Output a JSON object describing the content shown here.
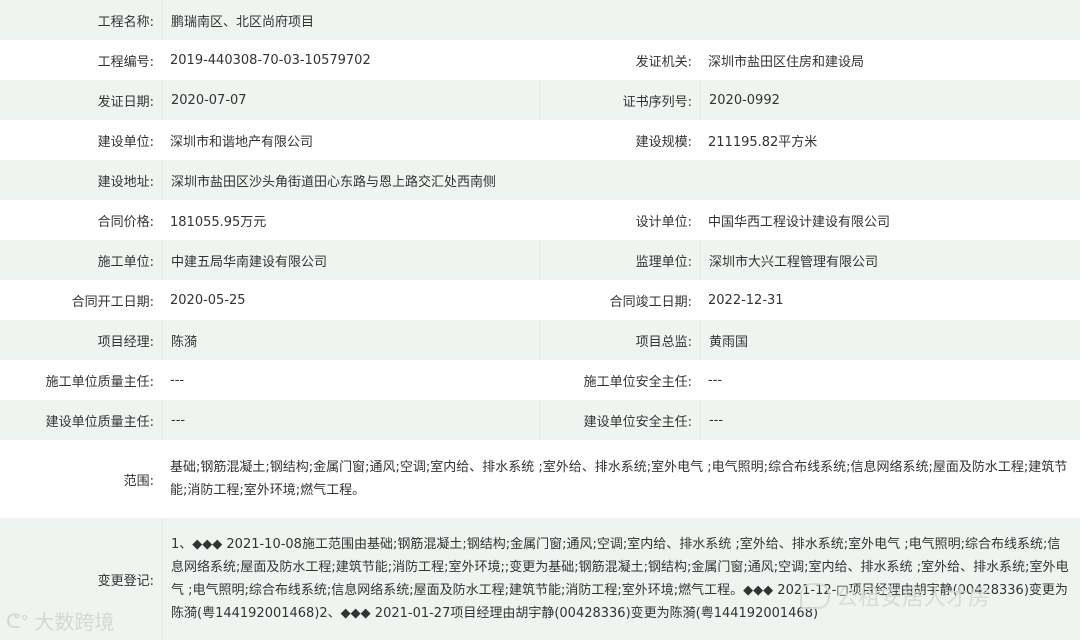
{
  "rows": [
    {
      "l1": "工程名称:",
      "v1": "鹏瑞南区、北区尚府项目"
    },
    {
      "l1": "工程编号:",
      "v1": "2019-440308-70-03-10579702",
      "l2": "发证机关:",
      "v2": "深圳市盐田区住房和建设局"
    },
    {
      "l1": "发证日期:",
      "v1": "2020-07-07",
      "l2": "证书序列号:",
      "v2": "2020-0992"
    },
    {
      "l1": "建设单位:",
      "v1": "深圳市和谐地产有限公司",
      "l2": "建设规模:",
      "v2": "211195.82平方米"
    },
    {
      "l1": "建设地址:",
      "v1": "深圳市盐田区沙头角街道田心东路与恩上路交汇处西南侧"
    },
    {
      "l1": "合同价格:",
      "v1": "181055.95万元",
      "l2": "设计单位:",
      "v2": "中国华西工程设计建设有限公司"
    },
    {
      "l1": "施工单位:",
      "v1": "中建五局华南建设有限公司",
      "l2": "监理单位:",
      "v2": "深圳市大兴工程管理有限公司"
    },
    {
      "l1": "合同开工日期:",
      "v1": "2020-05-25",
      "l2": "合同竣工日期:",
      "v2": "2022-12-31"
    },
    {
      "l1": "项目经理:",
      "v1": "陈漪",
      "l2": "项目总监:",
      "v2": "黄雨国"
    },
    {
      "l1": "施工单位质量主任:",
      "v1": "---",
      "l2": "施工单位安全主任:",
      "v2": "---"
    },
    {
      "l1": "建设单位质量主任:",
      "v1": "---",
      "l2": "建设单位安全主任:",
      "v2": "---"
    },
    {
      "l1": "范围:",
      "v1": "基础;钢筋混凝土;钢结构;金属门窗;通风;空调;室内给、排水系统 ;室外给、排水系统;室外电气 ;电气照明;综合布线系统;信息网络系统;屋面及防水工程;建筑节能;消防工程;室外环境;燃气工程。"
    },
    {
      "l1": "变更登记:",
      "v1": "1、◆◆◆ 2021-10-08施工范围由基础;钢筋混凝土;钢结构;金属门窗;通风;空调;室内给、排水系统 ;室外给、排水系统;室外电气 ;电气照明;综合布线系统;信息网络系统;屋面及防水工程;建筑节能;消防工程;室外环境;;变更为基础;钢筋混凝土;钢结构;金属门窗;通风;空调;室内给、排水系统 ;室外给、排水系统;室外电气 ;电气照明;综合布线系统;信息网络系统;屋面及防水工程;建筑节能;消防工程;室外环境;燃气工程。◆◆◆ 2021-12-□项目经理由胡宇静(00428336)变更为陈漪(粤144192001468)2、◆◆◆ 2021-01-27项目经理由胡宇静(00428336)变更为陈漪(粤144192001468)"
    }
  ],
  "watermark_left": "大数跨境",
  "watermark_right": "公租安居人才房"
}
